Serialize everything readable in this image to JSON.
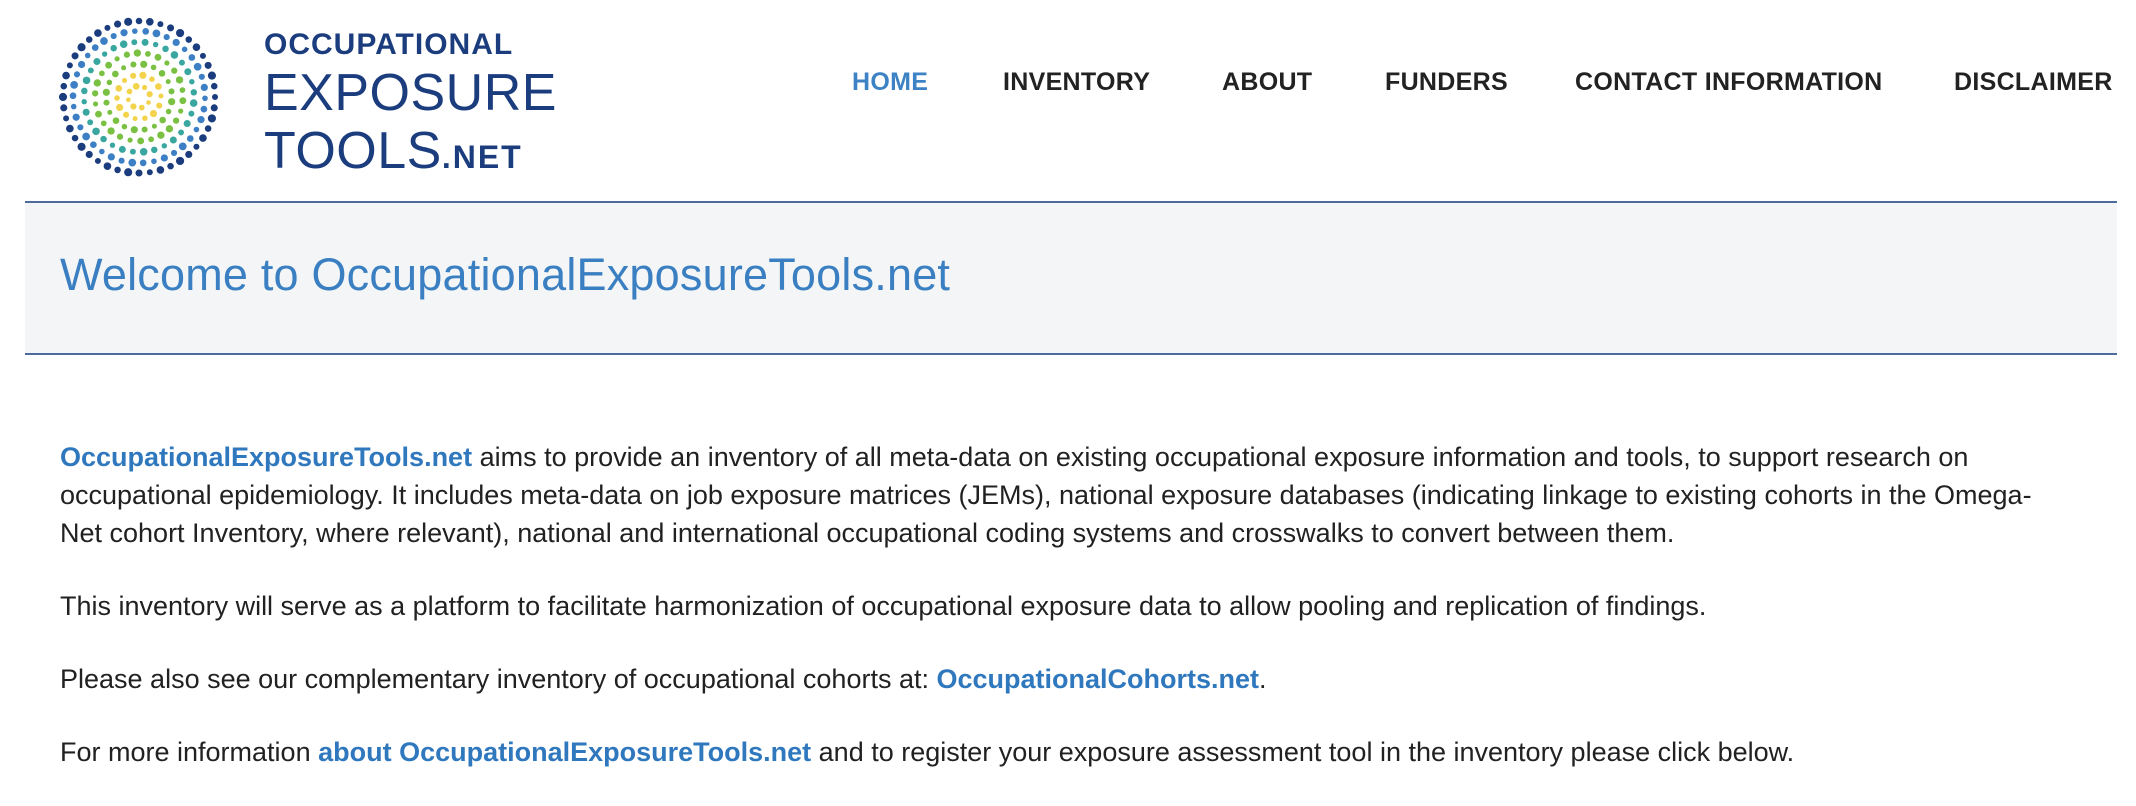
{
  "logo": {
    "line1": "OCCUPATIONAL",
    "line2": "EXPOSURE",
    "line3_main": "TOOLS",
    "line3_suffix": ".NET",
    "icon": "concentric-dots-logo-icon",
    "colors": [
      "#1b3d7e",
      "#3d7fc4",
      "#3aa6a0",
      "#7ac143",
      "#f2d34b"
    ]
  },
  "nav": {
    "items": [
      {
        "label": "HOME",
        "active": true
      },
      {
        "label": "INVENTORY",
        "active": false
      },
      {
        "label": "ABOUT",
        "active": false
      },
      {
        "label": "FUNDERS",
        "active": false
      },
      {
        "label": "CONTACT INFORMATION",
        "active": false
      },
      {
        "label": "DISCLAIMER",
        "active": false
      }
    ],
    "active_color": "#3d82c4"
  },
  "banner": {
    "title": "Welcome to OccupationalExposureTools.net"
  },
  "content": {
    "p1": {
      "link": "OccupationalExposureTools.net",
      "text": " aims to provide an inventory of all meta-data on existing occupational exposure information and tools, to support research on occupational epidemiology. It includes meta-data on job exposure matrices (JEMs), national exposure databases (indicating linkage to existing cohorts in the Omega-Net cohort Inventory, where relevant), national and international occupational coding systems and crosswalks to convert between them."
    },
    "p2": {
      "text": "This inventory will serve as a platform to facilitate harmonization of occupational exposure data to allow pooling and replication of findings."
    },
    "p3": {
      "before": "Please also see our complementary inventory of occupational cohorts at: ",
      "link": "OccupationalCohorts.net",
      "after": "."
    },
    "p4": {
      "before": "For more information ",
      "link": "about OccupationalExposureTools.net",
      "after": " and to register your exposure assessment tool in the inventory please click below."
    }
  }
}
